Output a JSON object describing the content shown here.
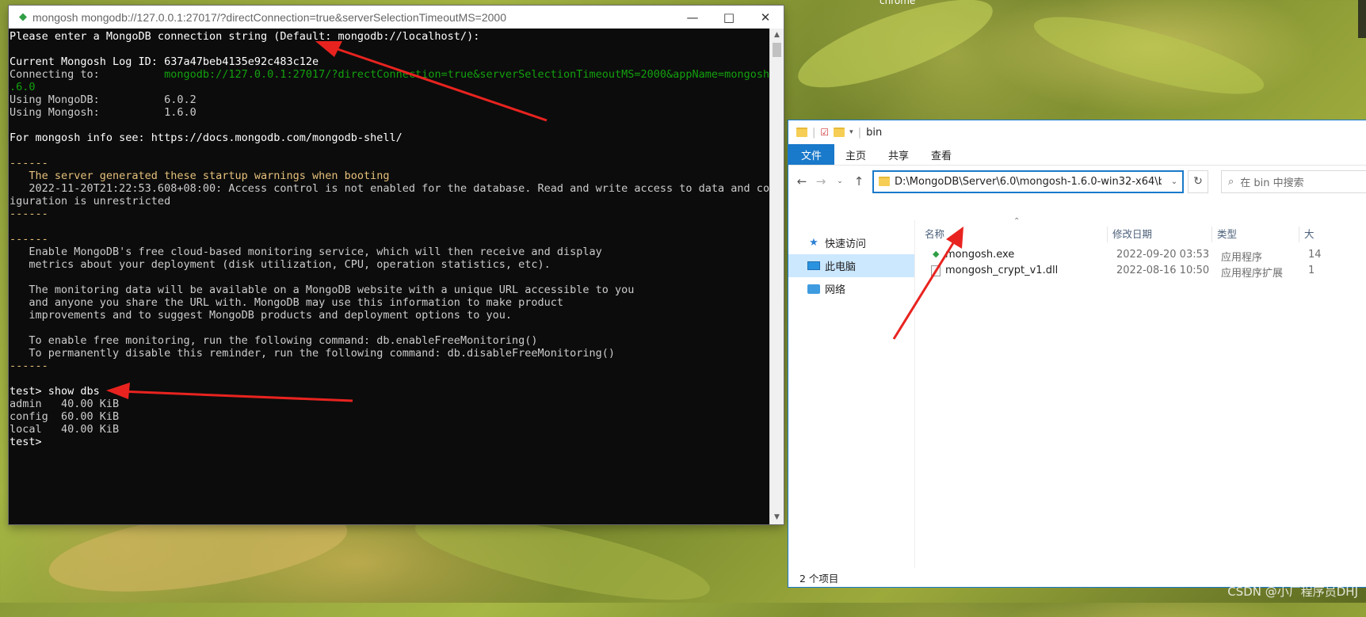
{
  "terminal": {
    "title": "mongosh mongodb://127.0.0.1:27017/?directConnection=true&serverSelectionTimeoutMS=2000",
    "lines": [
      {
        "text": "Please enter a MongoDB connection string (Default: mongodb://localhost/):",
        "style": "white"
      },
      {
        "text": "",
        "style": ""
      },
      {
        "text": "Current Mongosh Log ID: 637a47beb4135e92c483c12e",
        "style": "white"
      },
      {
        "text": "Connecting to:          ",
        "style": "",
        "extra": "mongodb://127.0.0.1:27017/?directConnection=true&serverSelectionTimeoutMS=2000&appName=mongosh+1",
        "extra_style": "green"
      },
      {
        "text": ".6.0",
        "style": "green"
      },
      {
        "text": "Using MongoDB:          6.0.2",
        "style": ""
      },
      {
        "text": "Using Mongosh:          1.6.0",
        "style": ""
      },
      {
        "text": "",
        "style": ""
      },
      {
        "text": "For mongosh info see: https://docs.mongodb.com/mongodb-shell/",
        "style": "white"
      },
      {
        "text": "",
        "style": ""
      },
      {
        "text": "------",
        "style": "yellow"
      },
      {
        "text": "   The server generated these startup warnings when booting",
        "style": "yellow"
      },
      {
        "text": "   2022-11-20T21:22:53.608+08:00: Access control is not enabled for the database. Read and write access to data and conf",
        "style": ""
      },
      {
        "text": "iguration is unrestricted",
        "style": ""
      },
      {
        "text": "------",
        "style": "yellow"
      },
      {
        "text": "",
        "style": ""
      },
      {
        "text": "------",
        "style": "yellow"
      },
      {
        "text": "   Enable MongoDB's free cloud-based monitoring service, which will then receive and display",
        "style": ""
      },
      {
        "text": "   metrics about your deployment (disk utilization, CPU, operation statistics, etc).",
        "style": ""
      },
      {
        "text": "",
        "style": ""
      },
      {
        "text": "   The monitoring data will be available on a MongoDB website with a unique URL accessible to you",
        "style": ""
      },
      {
        "text": "   and anyone you share the URL with. MongoDB may use this information to make product",
        "style": ""
      },
      {
        "text": "   improvements and to suggest MongoDB products and deployment options to you.",
        "style": ""
      },
      {
        "text": "",
        "style": ""
      },
      {
        "text": "   To enable free monitoring, run the following command: db.enableFreeMonitoring()",
        "style": ""
      },
      {
        "text": "   To permanently disable this reminder, run the following command: db.disableFreeMonitoring()",
        "style": ""
      },
      {
        "text": "------",
        "style": "yellow"
      },
      {
        "text": "",
        "style": ""
      },
      {
        "text": "test> show dbs",
        "style": "white"
      },
      {
        "text": "admin   40.00 KiB",
        "style": ""
      },
      {
        "text": "config  60.00 KiB",
        "style": ""
      },
      {
        "text": "local   40.00 KiB",
        "style": ""
      },
      {
        "text": "test>",
        "style": "white"
      }
    ]
  },
  "explorer": {
    "folder_name": "bin",
    "ribbon_tabs": [
      "文件",
      "主页",
      "共享",
      "查看"
    ],
    "address": "D:\\MongoDB\\Server\\6.0\\mongosh-1.6.0-win32-x64\\bin",
    "search_placeholder": "在 bin 中搜索",
    "nav_items": [
      "快速访问",
      "此电脑",
      "网络"
    ],
    "columns": [
      "名称",
      "修改日期",
      "类型",
      "大"
    ],
    "files": [
      {
        "name": "mongosh.exe",
        "date": "2022-09-20 03:53",
        "type": "应用程序",
        "size": "14"
      },
      {
        "name": "mongosh_crypt_v1.dll",
        "date": "2022-08-16 10:50",
        "type": "应用程序扩展",
        "size": "1"
      }
    ],
    "status": "2 个项目"
  },
  "desktop": {
    "top_label": "chrome",
    "watermark": "CSDN @小厂程序员DHJ"
  },
  "colors": {
    "accent": "#1979ca",
    "arrow": "#e8231f",
    "console_bg": "#0c0c0c",
    "console_green": "#13a10e",
    "console_yellow": "#e5c07b"
  }
}
